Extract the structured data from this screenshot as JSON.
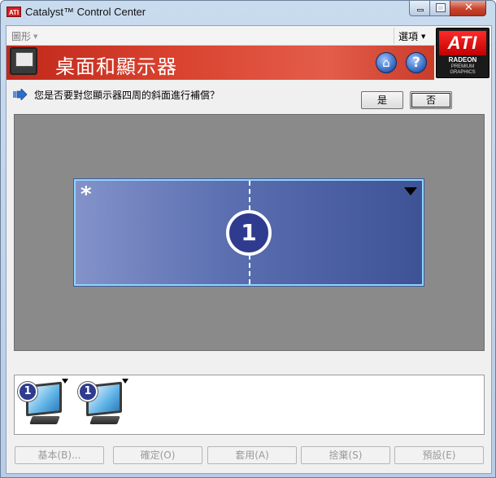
{
  "window": {
    "title": "Catalyst™ Control Center",
    "logo_text": "ATI",
    "minimize_glyph": "",
    "close_glyph": "✕"
  },
  "menubar": {
    "graphics_label": "圖形",
    "options_label": "選項"
  },
  "badge": {
    "brand": "ATI",
    "line1": "RADEON",
    "line2": "PREMIUM",
    "line3": "GRAPHICS"
  },
  "banner": {
    "title": "桌面和顯示器",
    "home_icon": "⌂",
    "help_icon": "?"
  },
  "prompt": {
    "question": "您是否要對您顯示器四周的斜面進行補償？",
    "yes_label": "是",
    "no_label": "否"
  },
  "desktop": {
    "star": "*",
    "display_number": "1"
  },
  "monitors": [
    {
      "number": "1"
    },
    {
      "number": "1"
    }
  ],
  "footer": {
    "basic_label": "基本(B)...",
    "ok_label": "確定(O)",
    "apply_label": "套用(A)",
    "discard_label": "捨棄(S)",
    "defaults_label": "預設(E)"
  },
  "colors": {
    "banner_red": "#d9432f",
    "display_blue": "#5a6eb0",
    "canvas_gray": "#8a8a8a"
  }
}
